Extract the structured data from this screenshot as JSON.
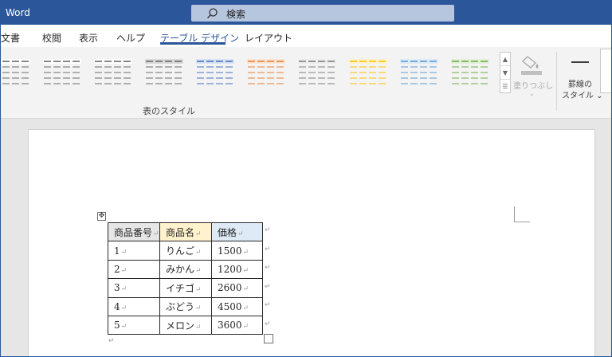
{
  "app": {
    "name": "Word"
  },
  "search": {
    "label": "検索",
    "icon": "search-icon"
  },
  "tabs": [
    {
      "label": "文書",
      "active": false
    },
    {
      "label": "校閲",
      "active": false
    },
    {
      "label": "表示",
      "active": false
    },
    {
      "label": "ヘルプ",
      "active": false
    },
    {
      "label": "テーブル デザイン",
      "active": true
    },
    {
      "label": "レイアウト",
      "active": false
    }
  ],
  "ribbon": {
    "styles_group_label": "表のスタイル",
    "shading_label": "塗りつぶし",
    "border_styles_label_line1": "罫線の",
    "border_styles_label_line2": "スタイル ⌄",
    "style_thumbs": [
      {
        "accent": "#6b6b6b",
        "header": "#ffffff"
      },
      {
        "accent": "#6b6b6b",
        "header": "#ffffff"
      },
      {
        "accent": "#6b6b6b",
        "header": "#ffffff"
      },
      {
        "accent": "#6b6b6b",
        "header": "#d9d9d9"
      },
      {
        "accent": "#4472c4",
        "header": "#dae3f3"
      },
      {
        "accent": "#ed7d31",
        "header": "#fbe5d6"
      },
      {
        "accent": "#7f7f7f",
        "header": "#ededed"
      },
      {
        "accent": "#ffc000",
        "header": "#fff2cc"
      },
      {
        "accent": "#5b9bd5",
        "header": "#deebf7"
      },
      {
        "accent": "#70ad47",
        "header": "#e2f0d9"
      }
    ]
  },
  "colors": {
    "accent": "#2b579a",
    "header_col1": "#e7e6e6",
    "header_col2": "#fff2cc",
    "header_col3": "#deebf7"
  },
  "table": {
    "headers": [
      "商品番号",
      "商品名",
      "価格"
    ],
    "rows": [
      [
        "1",
        "りんご",
        "1500"
      ],
      [
        "2",
        "みかん",
        "1200"
      ],
      [
        "3",
        "イチゴ",
        "2600"
      ],
      [
        "4",
        "ぶどう",
        "4500"
      ],
      [
        "5",
        "メロン",
        "3600"
      ]
    ],
    "paragraph_mark": "↵"
  }
}
